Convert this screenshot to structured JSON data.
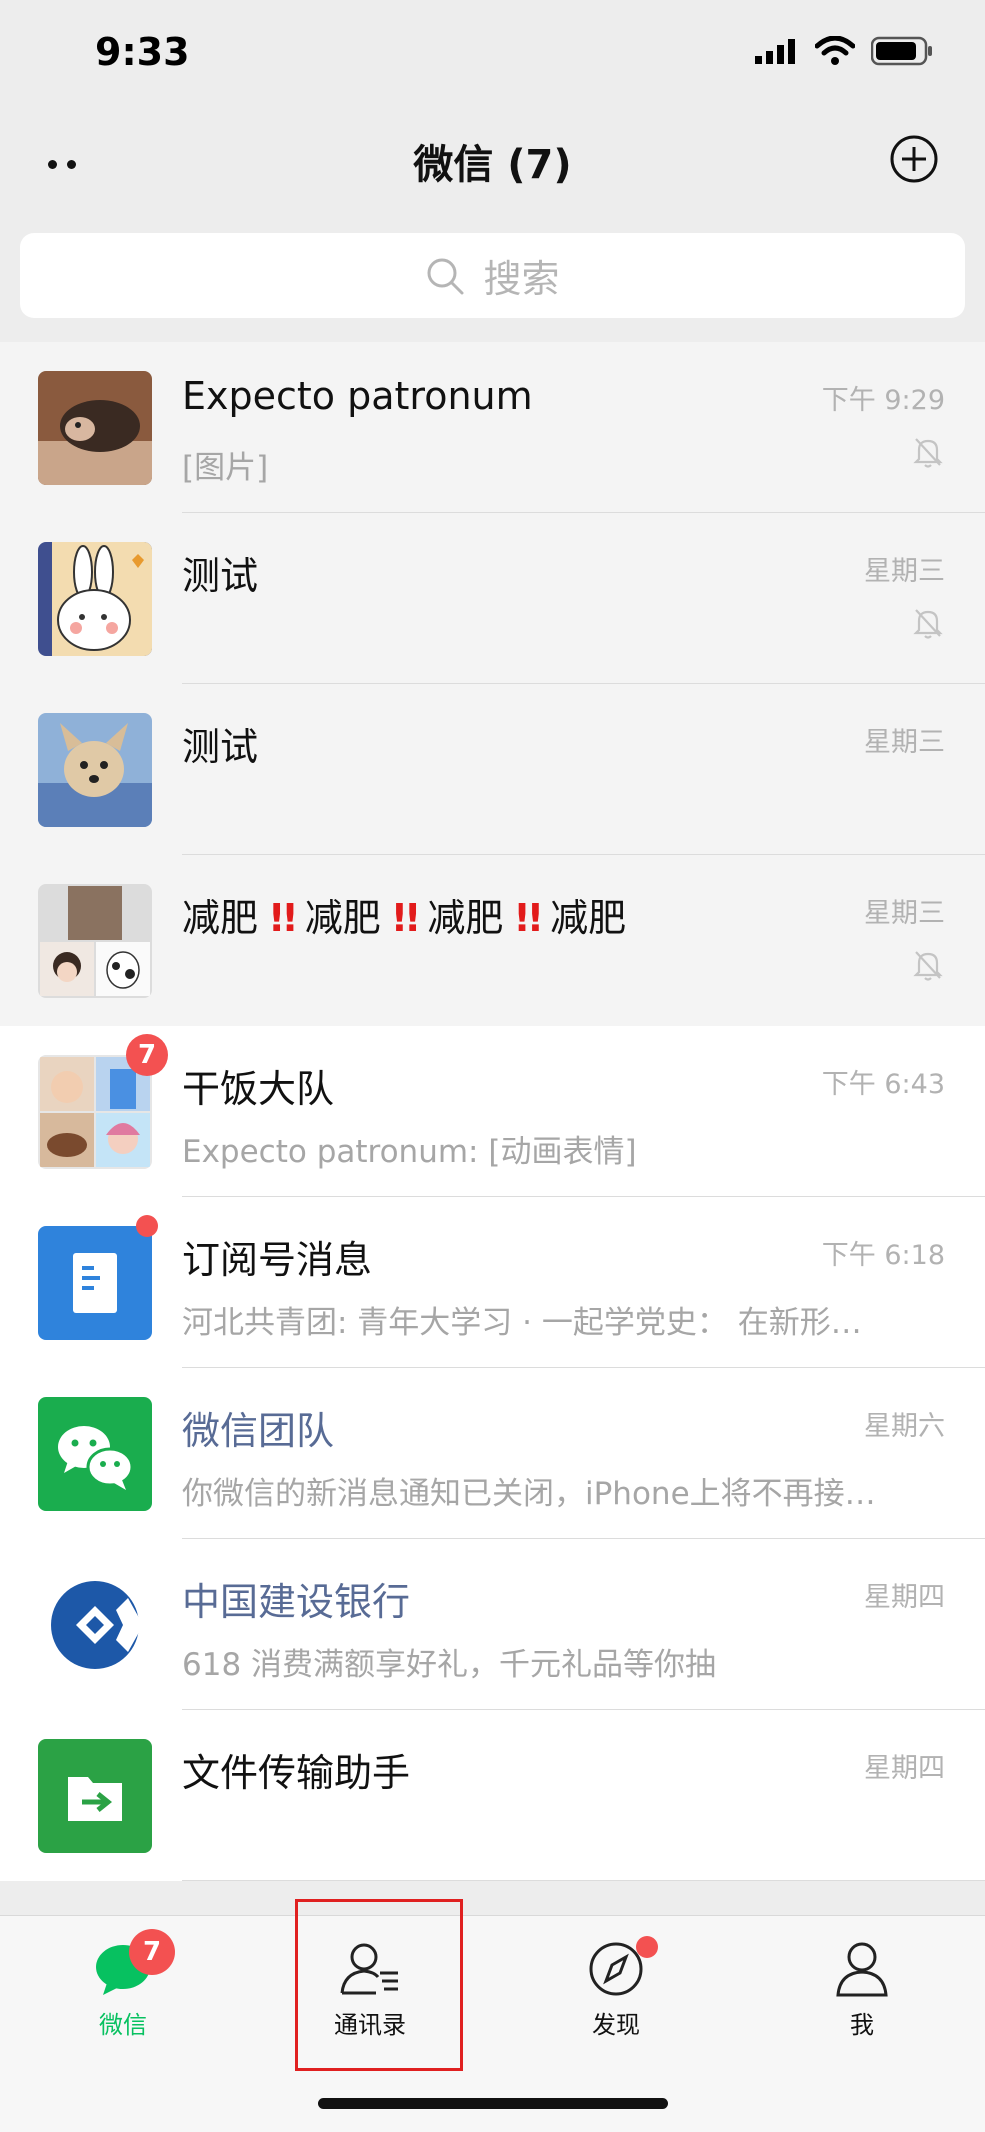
{
  "status_bar": {
    "time": "9:33"
  },
  "header": {
    "title": "微信 (7)"
  },
  "search": {
    "placeholder": "搜索"
  },
  "chats": [
    {
      "name": "Expecto patronum",
      "preview": "[图片]",
      "time": "下午 9:29",
      "muted": true,
      "pinned": true
    },
    {
      "name": "测试",
      "preview": "",
      "time": "星期三",
      "muted": true,
      "pinned": true
    },
    {
      "name": "测试",
      "preview": "",
      "time": "星期三",
      "muted": false,
      "pinned": true
    },
    {
      "name_parts": [
        "减肥",
        "!!",
        "减肥",
        "!!",
        "减肥",
        "!!",
        "减肥"
      ],
      "preview": "",
      "time": "星期三",
      "muted": true,
      "pinned": true
    },
    {
      "name": "干饭大队",
      "preview": "Expecto patronum: [动画表情]",
      "time": "下午 6:43",
      "badge": "7"
    },
    {
      "name": "订阅号消息",
      "preview": "河北共青团: 青年大学习 · 一起学党史： 在新形…",
      "time": "下午 6:18",
      "dot": true
    },
    {
      "name": "微信团队",
      "preview": "你微信的新消息通知已关闭，iPhone上将不再接…",
      "time": "星期六"
    },
    {
      "name": "中国建设银行",
      "preview": "618 消费满额享好礼，千元礼品等你抽",
      "time": "星期四"
    },
    {
      "name": "文件传输助手",
      "preview": "",
      "time": "星期四"
    }
  ],
  "tabs": [
    {
      "label": "微信",
      "active": true,
      "badge": "7"
    },
    {
      "label": "通讯录",
      "highlighted": true
    },
    {
      "label": "发现",
      "dot": true
    },
    {
      "label": "我"
    }
  ],
  "colors": {
    "accent_green": "#07c160",
    "badge_red": "#f35151",
    "link_blue": "#586b95",
    "highlight_red": "#e02020"
  }
}
